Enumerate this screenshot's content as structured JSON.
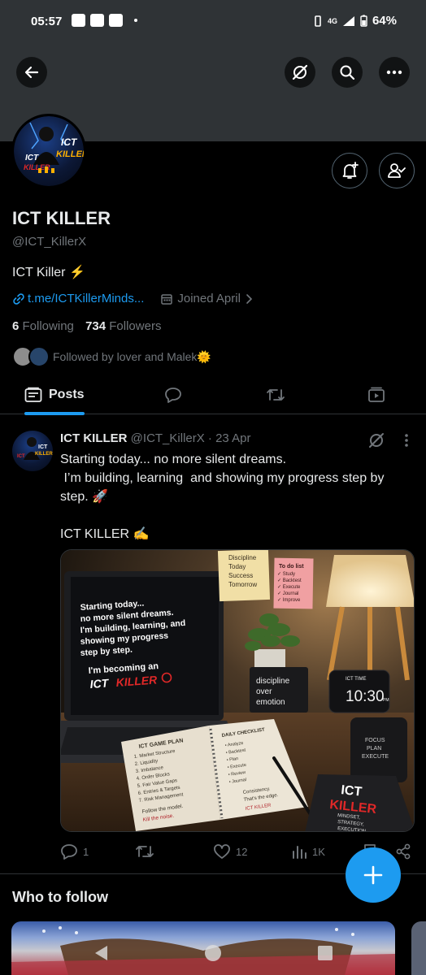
{
  "status_bar": {
    "time": "05:57",
    "network": "4G",
    "battery": "64%"
  },
  "header": {
    "back_icon": "arrow-left-icon",
    "no_notifications_icon": "bell-off-icon",
    "search_icon": "search-icon",
    "more_icon": "more-horizontal-icon"
  },
  "profile": {
    "avatar_text": "ICT KILLER",
    "name": "ICT KILLER",
    "handle": "@ICT_KillerX",
    "bio": "ICT Killer ⚡",
    "link": "t.me/ICTKillerMinds...",
    "joined": "Joined April",
    "following_count": "6",
    "following_label": "Following",
    "followers_count": "734",
    "followers_label": "Followers",
    "followed_by": "Followed by lover and Malek🌞"
  },
  "tabs": [
    {
      "label": "Posts",
      "icon": "posts-icon",
      "active": true
    },
    {
      "label": "",
      "icon": "replies-icon",
      "active": false
    },
    {
      "label": "",
      "icon": "retweet-icon",
      "active": false
    },
    {
      "label": "",
      "icon": "media-icon",
      "active": false
    }
  ],
  "tweet": {
    "author": "ICT KILLER",
    "handle": "@ICT_KillerX",
    "separator": "·",
    "date": "23 Apr",
    "text": "Starting today... no more silent dreams.\n I’m building, learning  and showing my progress step by step. 🚀\n\nICT KILLER ✍️",
    "image": {
      "laptop_text": [
        "Starting today...",
        "no more silent dreams.",
        "I'm building, learning, and",
        "showing my progress",
        "step by step."
      ],
      "laptop_brand_prefix": "I'm becoming an",
      "laptop_brand": "ICT",
      "laptop_brand_accent": "KILLER",
      "sticky_yellow": [
        "Discipline",
        "Today",
        "Success",
        "Tomorrow"
      ],
      "sticky_pink_title": "To do list",
      "sticky_pink_items": [
        "✓ Study",
        "✓ Backtest",
        "✓ Execute",
        "✓ Journal",
        "✓ Improve"
      ],
      "card_text": [
        "discipline",
        "over",
        "emotion"
      ],
      "clock_label": "ICT TIME",
      "clock_time": "10:30",
      "clock_suffix": "PM",
      "notebook_title": "ICT GAME PLAN",
      "notebook_items": [
        "1. Market Structure",
        "2. Liquidity",
        "3. Imbalance",
        "4. Order Blocks",
        "5. Fair Value Gaps",
        "6. Entries & Targets",
        "7. Risk Management"
      ],
      "notebook_footer": [
        "Follow the model.",
        "Kill the noise."
      ],
      "checklist_title": "DAILY CHECKLIST",
      "checklist_items": [
        "• Analyze",
        "• Backtest",
        "• Plan",
        "• Execute",
        "• Review",
        "• Journal"
      ],
      "checklist_footer": [
        "Consistency.",
        "That's the edge.",
        "ICT KILLER"
      ],
      "mug_text": [
        "FOCUS",
        "PLAN",
        "EXECUTE"
      ],
      "book_title": [
        "ICT",
        "KILLER"
      ],
      "book_sub": [
        "MINDSET,",
        "STRATEGY,",
        "EXECUTION"
      ]
    },
    "replies": "1",
    "retweets": "",
    "likes": "12",
    "views": "1K"
  },
  "who_to_follow": {
    "title": "Who to follow"
  },
  "colors": {
    "accent": "#1d9bf0",
    "text_secondary": "#71767b",
    "border": "#2f3336"
  }
}
